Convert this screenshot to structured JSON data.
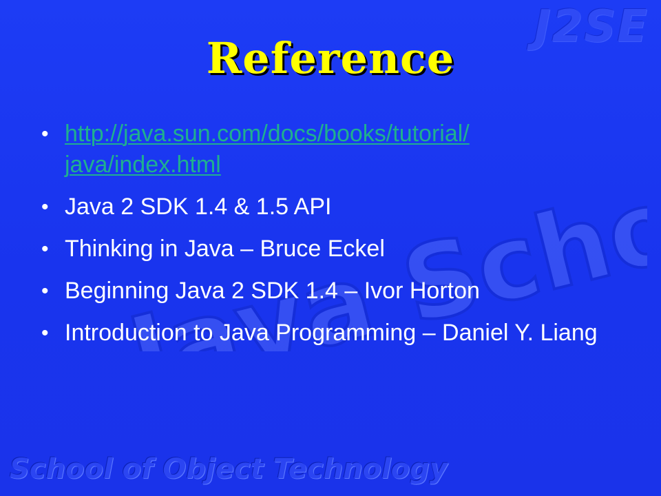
{
  "slide": {
    "corner_mark": "J2SE",
    "title": "Reference",
    "items": [
      {
        "text": "http://java.sun.com/docs/books/tutorial/\njava/index.html",
        "is_link": true
      },
      {
        "text": "Java 2 SDK 1.4 & 1.5 API",
        "is_link": false
      },
      {
        "text": "Thinking in Java – Bruce Eckel",
        "is_link": false
      },
      {
        "text": "Beginning Java 2 SDK 1.4 – Ivor Horton",
        "is_link": false
      },
      {
        "text": "Introduction to Java Programming – Daniel Y. Liang",
        "is_link": false
      }
    ],
    "watermark_text": "Java School",
    "footer": "School of Object Technology",
    "bullet_glyph": "•"
  },
  "colors": {
    "background": "#1a34f0",
    "title": "#ffff00",
    "text": "#ffffff",
    "link": "#1fb08f"
  }
}
